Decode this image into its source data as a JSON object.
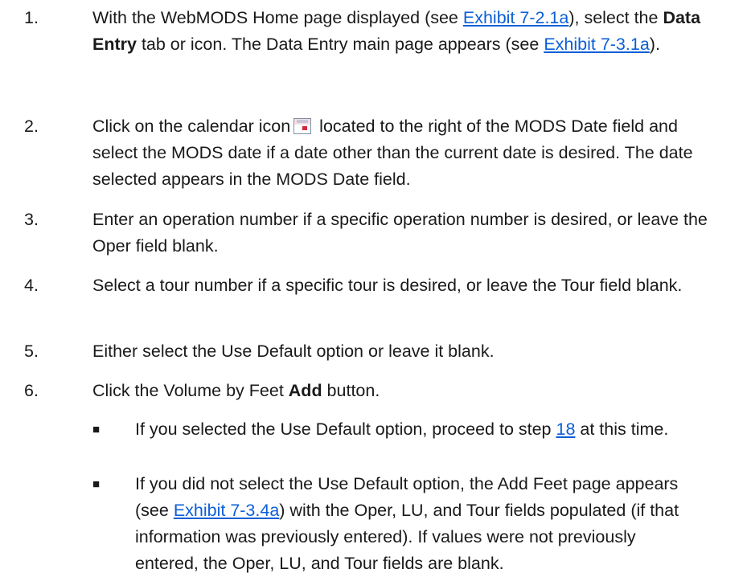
{
  "steps": [
    {
      "num": "1.",
      "t1": "With the WebMODS Home page displayed (see ",
      "link1": "Exhibit 7-2.1a",
      "t2": "), select the ",
      "bold1": "Data Entry",
      "t3": " tab or icon. The Data Entry main page appears (see ",
      "link2": "Exhibit 7-3.1a",
      "t4": ")."
    },
    {
      "num": "2.",
      "t1": "Click on the calendar icon",
      "icon": "calendar-icon",
      "t2": " located to the right of the MODS Date field and select the MODS date if a date other than the current date is desired. The date selected appears in the MODS Date field."
    },
    {
      "num": "3.",
      "t1": "Enter an operation number if a specific operation number is desired, or leave the Oper field blank."
    },
    {
      "num": "4.",
      "t1": "Select a tour number if a specific tour is desired, or leave the Tour field blank."
    },
    {
      "num": "5.",
      "t1": "Either select the Use Default option or leave it blank."
    },
    {
      "num": "6.",
      "t1": "Click the Volume by Feet ",
      "bold1": "Add",
      "t2": " button."
    }
  ],
  "bullets": [
    {
      "mark": "■",
      "t1": "If you selected the Use Default option, proceed to step ",
      "link1": "18",
      "t2": " at this time."
    },
    {
      "mark": "■",
      "t1": "If you did not select the Use Default option, the Add Feet page appears (see ",
      "link1": "Exhibit 7-3.4a",
      "t2": ") with the Oper, LU, and Tour fields populated (if that information was previously entered). If values were not previously entered, the Oper, LU, and Tour fields are blank."
    }
  ]
}
